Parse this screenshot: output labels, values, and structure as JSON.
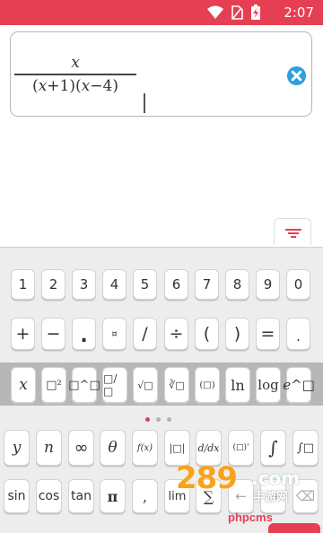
{
  "status_bar": {
    "time": "2:07",
    "battery_color": "#ffffff",
    "bg_color": "#e63e52"
  },
  "expression": {
    "numerator": "x",
    "denominator": {
      "open1": "(",
      "var1": "x",
      "op1": "+",
      "num1": "1",
      "close1": ")",
      "open2": "(",
      "var2": "x",
      "op2": "−",
      "num2": "4",
      "close2": ")"
    },
    "clear_icon": "close-circle-icon"
  },
  "keyboard_toggle_icon": "filter-icon",
  "keyboard": {
    "row_digits": [
      "1",
      "2",
      "3",
      "4",
      "5",
      "6",
      "7",
      "8",
      "9",
      "0"
    ],
    "row_ops": [
      "+",
      "−",
      ".",
      "¤",
      "/",
      "÷",
      "(",
      ")",
      "=",
      "."
    ],
    "row_funcs": [
      "x",
      "□²",
      "□^□",
      "□/□",
      "√□",
      "∛□",
      "(□)",
      "ln",
      "log",
      "e^□"
    ],
    "row_symbols": [
      "y",
      "n",
      "∞",
      "θ",
      "f(x)",
      "|□|",
      "d/dx",
      "(□)'",
      "∫",
      "∫□"
    ],
    "row_trig": [
      "sin",
      "cos",
      "tan",
      "π",
      ",",
      "lim",
      "∑",
      "←",
      "→",
      "⌫"
    ],
    "page_indicator": {
      "count": 3,
      "active": 0
    }
  },
  "watermark": {
    "brand": "289",
    "domain": ".com",
    "subtitle": "手游网",
    "footer": "phpcms"
  }
}
